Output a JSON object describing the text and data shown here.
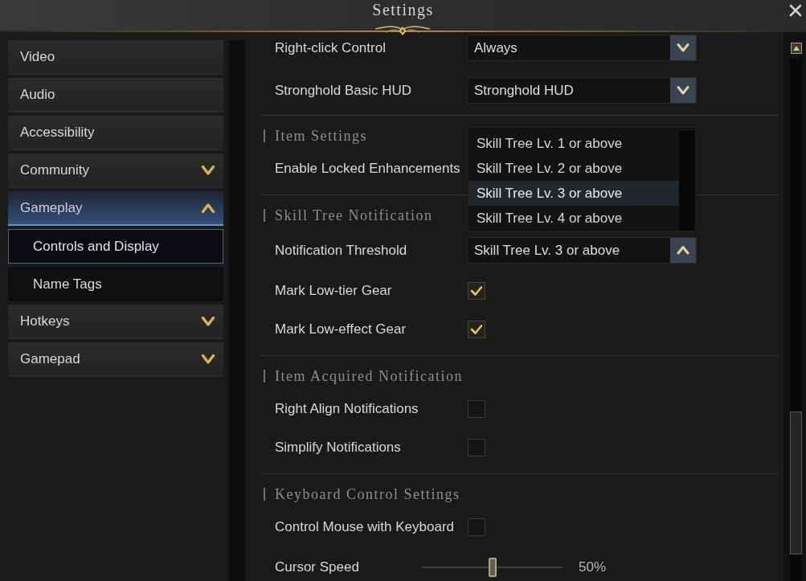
{
  "window": {
    "title": "Settings"
  },
  "sidebar": {
    "items": [
      {
        "kind": "page",
        "label": "Video",
        "selected": false
      },
      {
        "kind": "page",
        "label": "Audio",
        "selected": false
      },
      {
        "kind": "page",
        "label": "Accessibility",
        "selected": false
      },
      {
        "kind": "group",
        "label": "Community",
        "selected": false,
        "expanded": false
      },
      {
        "kind": "group",
        "label": "Gameplay",
        "selected": true,
        "expanded": true,
        "children": [
          {
            "label": "Controls and Display",
            "selected": true
          },
          {
            "label": "Name Tags",
            "selected": false
          }
        ]
      },
      {
        "kind": "group",
        "label": "Hotkeys",
        "selected": false,
        "expanded": false
      },
      {
        "kind": "group",
        "label": "Gamepad",
        "selected": false,
        "expanded": false
      }
    ]
  },
  "settings": {
    "sections": [
      {
        "rows": [
          {
            "kind": "dropdown",
            "label": "Right-click Control",
            "value": "Always",
            "expanded": false
          },
          {
            "kind": "dropdown",
            "label": "Stronghold Basic HUD",
            "value": "Stronghold HUD",
            "expanded": false
          }
        ]
      },
      {
        "title": "Item Settings",
        "rows": [
          {
            "kind": "label",
            "label": "Enable Locked Enhancements"
          }
        ]
      },
      {
        "title": "Skill Tree Notification",
        "rows": [
          {
            "kind": "dropdown",
            "label": "Notification Threshold",
            "value": "Skill Tree Lv. 3 or above",
            "expanded": true,
            "options": [
              {
                "label": "Skill Tree Lv. 1 or above",
                "selected": false
              },
              {
                "label": "Skill Tree Lv. 2 or above",
                "selected": false
              },
              {
                "label": "Skill Tree Lv. 3 or above",
                "selected": true
              },
              {
                "label": "Skill Tree Lv. 4 or above",
                "selected": false
              }
            ]
          },
          {
            "kind": "checkbox",
            "label": "Mark Low-tier Gear",
            "checked": true
          },
          {
            "kind": "checkbox",
            "label": "Mark Low-effect Gear",
            "checked": true
          }
        ]
      },
      {
        "title": "Item Acquired Notification",
        "rows": [
          {
            "kind": "checkbox",
            "label": "Right Align Notifications",
            "checked": false
          },
          {
            "kind": "checkbox",
            "label": "Simplify Notifications",
            "checked": false
          }
        ]
      },
      {
        "title": "Keyboard Control Settings",
        "rows": [
          {
            "kind": "checkbox",
            "label": "Control Mouse with Keyboard",
            "checked": false
          },
          {
            "kind": "slider",
            "label": "Cursor Speed",
            "level": 0.5,
            "reading": "50%"
          }
        ]
      }
    ]
  }
}
